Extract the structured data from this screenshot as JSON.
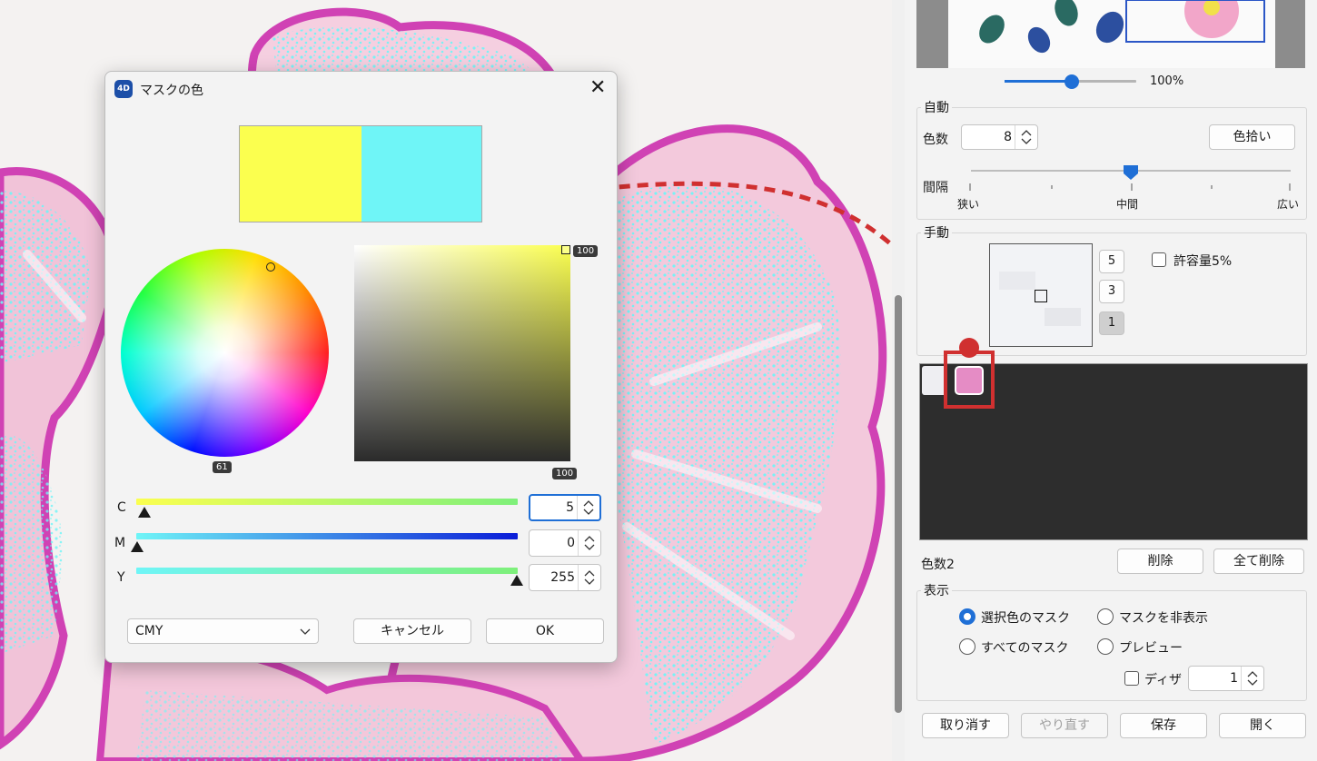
{
  "colors": {
    "accent": "#1f6fd6",
    "cyan_mask": "#6ff5f7",
    "yellow": "#fbff4f",
    "swatch_selected": "#e58cc5",
    "swatch_first": "#eeeef2",
    "palette_bg": "#2d2d2d",
    "callout_red": "#d03030",
    "petal_magenta": "#d042b4"
  },
  "panel": {
    "zoom": {
      "value": "100%",
      "level": 0.53
    },
    "auto": {
      "title": "自動",
      "color_count_label": "色数",
      "color_count": "8",
      "pick_button": "色拾い",
      "interval_label": "間隔",
      "interval_level": 0.5,
      "ticks": {
        "narrow": "狭い",
        "middle": "中間",
        "wide": "広い"
      }
    },
    "manual": {
      "title": "手動",
      "size_buttons": [
        "5",
        "3",
        "1"
      ],
      "tolerance_label": "許容量5%"
    },
    "palette": {
      "count_label": "色数2",
      "delete": "削除",
      "delete_all": "全て削除"
    },
    "display": {
      "title": "表示",
      "opt_selected_mask": "選択色のマスク",
      "opt_hide_mask": "マスクを非表示",
      "opt_all_masks": "すべてのマスク",
      "opt_preview": "プレビュー",
      "dither_label": "ディザ",
      "dither_value": "1"
    },
    "footer": {
      "undo": "取り消す",
      "redo": "やり直す",
      "save": "保存",
      "open": "開く"
    }
  },
  "dialog": {
    "icon_text": "4D",
    "title": "マスクの色",
    "wheel_value": "61",
    "sv_value_top": "100",
    "sv_value_bottom": "100",
    "sliders": [
      {
        "label": "C",
        "value": "5"
      },
      {
        "label": "M",
        "value": "0"
      },
      {
        "label": "Y",
        "value": "255"
      }
    ],
    "mode": "CMY",
    "cancel": "キャンセル",
    "ok": "OK"
  }
}
